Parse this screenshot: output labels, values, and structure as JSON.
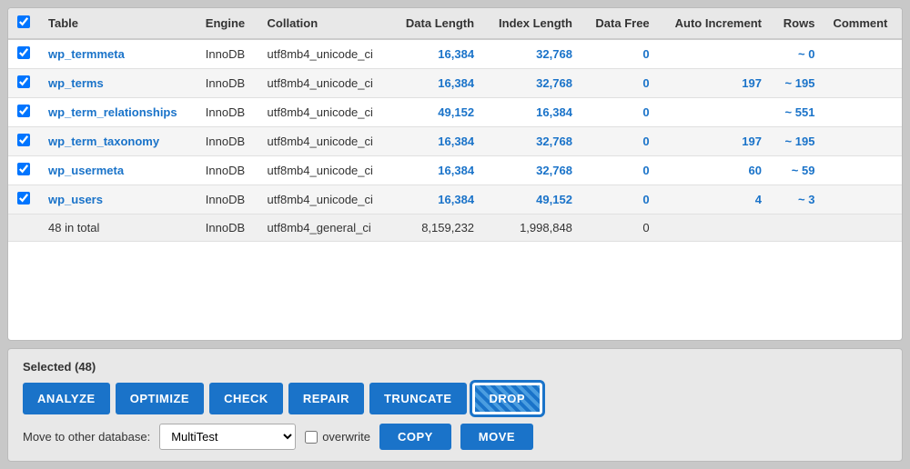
{
  "table": {
    "columns": [
      "",
      "Table",
      "Engine",
      "Collation",
      "Data Length",
      "Index Length",
      "Data Free",
      "Auto Increment",
      "Rows",
      "Comment"
    ],
    "rows": [
      {
        "checked": true,
        "name": "wp_termmeta",
        "engine": "InnoDB",
        "collation": "utf8mb4_unicode_ci",
        "data_length": "16,384",
        "index_length": "32,768",
        "data_free": "0",
        "auto_increment": "-",
        "rows": "~ 0",
        "comment": ""
      },
      {
        "checked": true,
        "name": "wp_terms",
        "engine": "InnoDB",
        "collation": "utf8mb4_unicode_ci",
        "data_length": "16,384",
        "index_length": "32,768",
        "data_free": "0",
        "auto_increment": "197",
        "rows": "~ 195",
        "comment": ""
      },
      {
        "checked": true,
        "name": "wp_term_relationships",
        "engine": "InnoDB",
        "collation": "utf8mb4_unicode_ci",
        "data_length": "49,152",
        "index_length": "16,384",
        "data_free": "0",
        "auto_increment": "-",
        "rows": "~ 551",
        "comment": ""
      },
      {
        "checked": true,
        "name": "wp_term_taxonomy",
        "engine": "InnoDB",
        "collation": "utf8mb4_unicode_ci",
        "data_length": "16,384",
        "index_length": "32,768",
        "data_free": "0",
        "auto_increment": "197",
        "rows": "~ 195",
        "comment": ""
      },
      {
        "checked": true,
        "name": "wp_usermeta",
        "engine": "InnoDB",
        "collation": "utf8mb4_unicode_ci",
        "data_length": "16,384",
        "index_length": "32,768",
        "data_free": "0",
        "auto_increment": "60",
        "rows": "~ 59",
        "comment": ""
      },
      {
        "checked": true,
        "name": "wp_users",
        "engine": "InnoDB",
        "collation": "utf8mb4_unicode_ci",
        "data_length": "16,384",
        "index_length": "49,152",
        "data_free": "0",
        "auto_increment": "4",
        "rows": "~ 3",
        "comment": ""
      }
    ],
    "total": {
      "label": "48 in total",
      "engine": "InnoDB",
      "collation": "utf8mb4_general_ci",
      "data_length": "8,159,232",
      "index_length": "1,998,848",
      "data_free": "0",
      "auto_increment": "",
      "rows": "",
      "comment": ""
    }
  },
  "bottom": {
    "selected_label": "Selected (48)",
    "buttons": {
      "analyze": "ANALYZE",
      "optimize": "OPTIMIZE",
      "check": "CHECK",
      "repair": "REPAIR",
      "truncate": "TRUNCATE",
      "drop": "DROP"
    },
    "move_label": "Move to other database:",
    "db_value": "MultiTest",
    "overwrite_label": "overwrite",
    "copy_label": "COPY",
    "move_label2": "MOVE"
  }
}
